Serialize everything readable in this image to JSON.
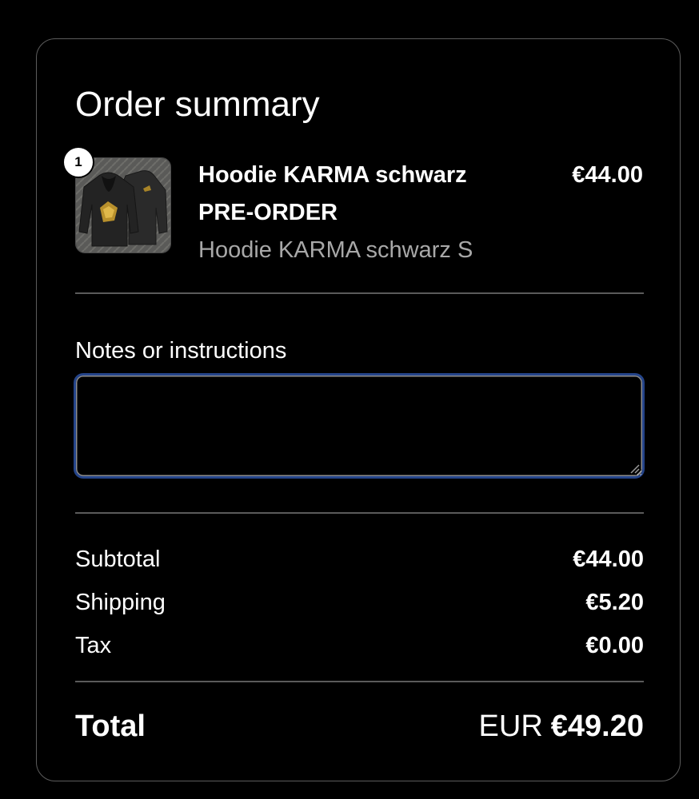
{
  "summary": {
    "title": "Order summary"
  },
  "line_item": {
    "quantity": "1",
    "name": "Hoodie KARMA schwarz PRE-ORDER",
    "variant": "Hoodie KARMA schwarz S",
    "price": "€44.00",
    "thumbnail_icon": "hoodie-product-image"
  },
  "notes": {
    "label": "Notes or instructions",
    "value": "",
    "placeholder": ""
  },
  "totals": {
    "subtotal_label": "Subtotal",
    "subtotal_value": "€44.00",
    "shipping_label": "Shipping",
    "shipping_value": "€5.20",
    "tax_label": "Tax",
    "tax_value": "€0.00",
    "total_label": "Total",
    "total_currency": "EUR",
    "total_value": "€49.20"
  },
  "colors": {
    "background": "#000000",
    "border": "#5c5c5c",
    "focus_ring": "#24448a",
    "muted_text": "#a8a8a8"
  }
}
